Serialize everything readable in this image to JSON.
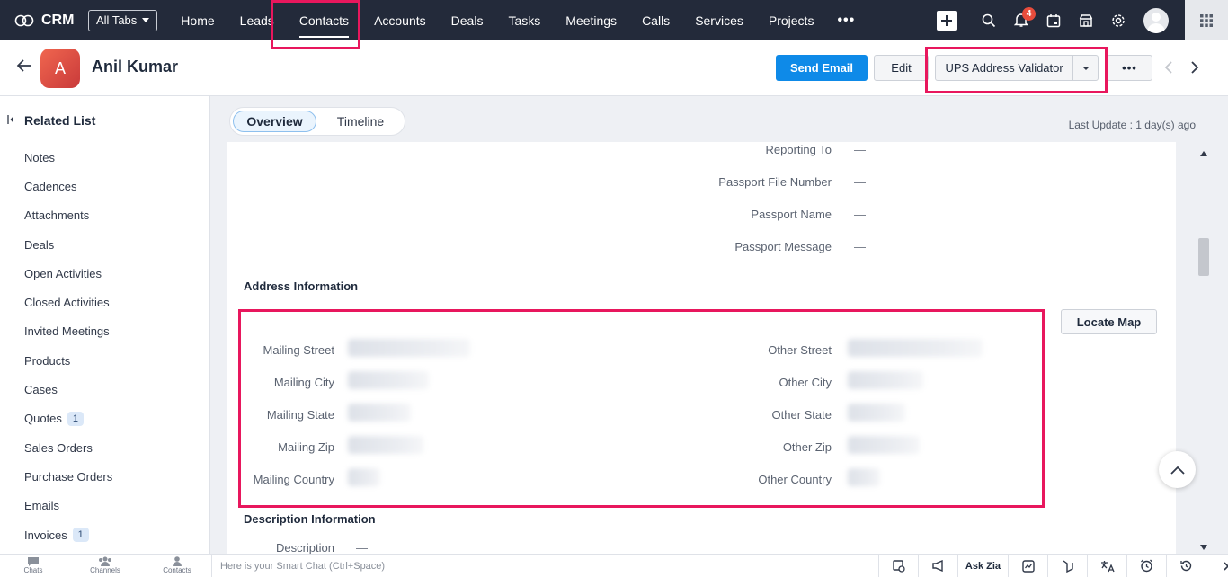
{
  "nav": {
    "brand": "CRM",
    "all_tabs": "All Tabs",
    "tabs": [
      "Home",
      "Leads",
      "Contacts",
      "Accounts",
      "Deals",
      "Tasks",
      "Meetings",
      "Calls",
      "Services",
      "Projects"
    ],
    "more": "•••",
    "notification_count": "4"
  },
  "record": {
    "avatar_letter": "A",
    "name": "Anil Kumar",
    "send_email": "Send Email",
    "edit": "Edit",
    "ups": "UPS Address Validator",
    "more": "•••"
  },
  "related": {
    "title": "Related List",
    "items": [
      {
        "label": "Notes",
        "badge": ""
      },
      {
        "label": "Cadences",
        "badge": ""
      },
      {
        "label": "Attachments",
        "badge": ""
      },
      {
        "label": "Deals",
        "badge": ""
      },
      {
        "label": "Open Activities",
        "badge": ""
      },
      {
        "label": "Closed Activities",
        "badge": ""
      },
      {
        "label": "Invited Meetings",
        "badge": ""
      },
      {
        "label": "Products",
        "badge": ""
      },
      {
        "label": "Cases",
        "badge": ""
      },
      {
        "label": "Quotes",
        "badge": "1"
      },
      {
        "label": "Sales Orders",
        "badge": ""
      },
      {
        "label": "Purchase Orders",
        "badge": ""
      },
      {
        "label": "Emails",
        "badge": ""
      },
      {
        "label": "Invoices",
        "badge": "1"
      }
    ]
  },
  "view": {
    "tab_overview": "Overview",
    "tab_timeline": "Timeline",
    "last_update": "Last Update : 1 day(s) ago"
  },
  "details": {
    "top_fields": [
      {
        "label": "Reporting To",
        "value": "—"
      },
      {
        "label": "Passport File Number",
        "value": "—"
      },
      {
        "label": "Passport Name",
        "value": "—"
      },
      {
        "label": "Passport Message",
        "value": "—"
      }
    ],
    "address_title": "Address Information",
    "mailing": [
      "Mailing Street",
      "Mailing City",
      "Mailing State",
      "Mailing Zip",
      "Mailing Country"
    ],
    "other": [
      "Other Street",
      "Other City",
      "Other State",
      "Other Zip",
      "Other Country"
    ],
    "locate_map": "Locate Map",
    "description_title": "Description Information",
    "description_label": "Description",
    "description_value": "—"
  },
  "bottom": {
    "chats": "Chats",
    "channels": "Channels",
    "contacts": "Contacts",
    "smart_chat": "Here is your Smart Chat (Ctrl+Space)",
    "ask_zia": "Ask Zia"
  }
}
